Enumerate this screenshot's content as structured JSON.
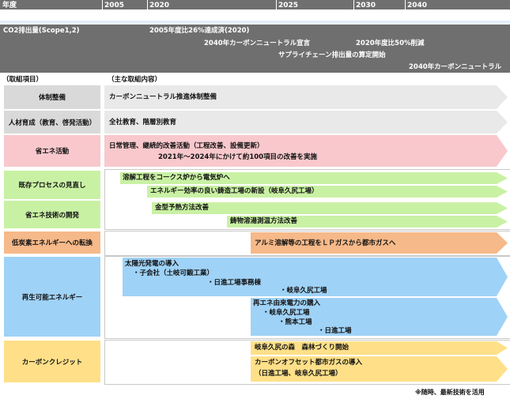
{
  "header": {
    "col_label": "年度",
    "years": [
      "2005",
      "2020",
      "2025",
      "2030",
      "2040"
    ]
  },
  "band": {
    "title": "CO2排出量(Scope1,2)",
    "m1": "2005年度比26%達成済(2020)",
    "m2": "2040年カーボンニュートラル宣言",
    "m3": "2020年度比50%削減",
    "m4": "サプライチェーン排出量の算定開始",
    "m5": "2040年カーボンニュートラル"
  },
  "section": {
    "left": "（取組項目）",
    "right": "（主な取組内容）"
  },
  "rows": {
    "taisei": {
      "label": "体制整備",
      "item": "カーボンニュートラル推進体制整備"
    },
    "jinzai": {
      "label": "人材育成（教育、啓発活動）",
      "item": "全社教育、階層別教育"
    },
    "shoene": {
      "label": "省エネ活動",
      "item1": "日常管理、継続的改善活動（工程改善、設備更新）",
      "item2": "2021年～2024年にかけて約100項目の改善を実施"
    },
    "kizon": {
      "label": "既存プロセスの見直し",
      "item1": "溶解工程をコークス炉から電気炉へ",
      "item2": "エネルギー効率の良い鋳造工場の新設（岐阜久尻工場）"
    },
    "gijutsu": {
      "label": "省エネ技術の開発",
      "item1": "金型予熱方法改善",
      "item2": "鋳物溶湯測温方法改善"
    },
    "teitanso": {
      "label": "低炭素エネルギーへの転換",
      "item": "アルミ溶解等の工程をＬＰガスから都市ガスへ"
    },
    "saisei": {
      "label": "再生可能エネルギー",
      "a1": "太陽光発電の導入",
      "a2": "・子会社（土岐可鍛工業）",
      "a3": "・日進工場事務棟",
      "a4": "・岐阜久尻工場",
      "b1": "再エネ由来電力の購入",
      "b2": "・岐阜久尻工場",
      "b3": "・熊本工場",
      "b4": "・日進工場"
    },
    "carbon": {
      "label": "カーボンクレジット",
      "item1": "岐阜久尻の森　森林づくり開始",
      "item2": "カーボンオフセット都市ガスの導入",
      "item3": "（日進工場、岐阜久尻工場）"
    }
  },
  "footnote": "※随時、最新技術を活用",
  "colors": {
    "header": "#6f6f6f",
    "gray_label": "#d9d9d9",
    "gray_arrow": "#e9e9e9",
    "pink": "#f8c8cc",
    "green": "#c9f1a4",
    "orange": "#f6b989",
    "blue": "#9fd2f7",
    "yellow": "#ffe089"
  }
}
